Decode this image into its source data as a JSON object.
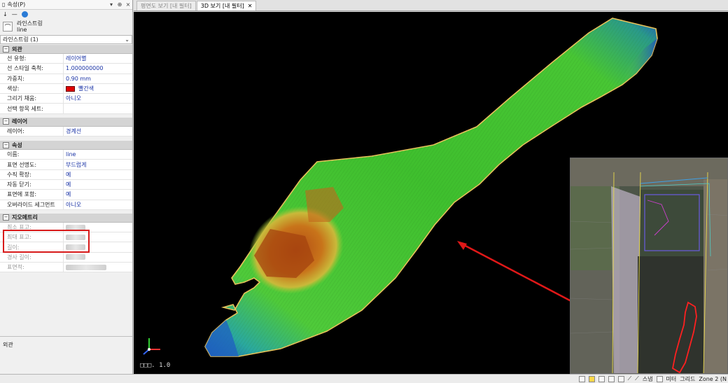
{
  "panel": {
    "title": "속성(P)",
    "object_type": "라인스트링",
    "object_name": "line",
    "selector": "라인스트링 (1)",
    "sections": {
      "appearance": {
        "title": "외관",
        "rows": [
          {
            "key": "선 유형:",
            "value": "레이어별"
          },
          {
            "key": "선 스타일 축척:",
            "value": "1.000000000"
          },
          {
            "key": "가중치:",
            "value": "0.90 mm"
          },
          {
            "key": "색상:",
            "value": "빨간색"
          },
          {
            "key": "그리기 채움:",
            "value": "아니오"
          },
          {
            "key": "선택 항목 세트:",
            "value": ""
          }
        ]
      },
      "layer": {
        "title": "레이어",
        "rows": [
          {
            "key": "레이어:",
            "value": "경계선"
          }
        ]
      },
      "attributes": {
        "title": "속성",
        "rows": [
          {
            "key": "이름:",
            "value": "line"
          },
          {
            "key": "표면 선명도:",
            "value": "부드럽게"
          },
          {
            "key": "수직 확장:",
            "value": "예"
          },
          {
            "key": "자동 닫기:",
            "value": "예"
          },
          {
            "key": "표면에 포함:",
            "value": "예"
          },
          {
            "key": "오버라이드 세그먼트",
            "value": "아니오"
          }
        ]
      },
      "geometry": {
        "title": "지오메트리",
        "rows": [
          {
            "key": "최소 표고:"
          },
          {
            "key": "최대 표고:"
          },
          {
            "key": "길이:"
          },
          {
            "key": "경사 길이:"
          },
          {
            "key": "표면적:"
          }
        ]
      }
    },
    "footer_label": "외관"
  },
  "tabs": [
    {
      "label": "평면도 보기 [내 필터]",
      "active": false
    },
    {
      "label": "3D 보기 [내 필터]",
      "active": true
    }
  ],
  "viewport": {
    "scale_label": "□□□. 1.0"
  },
  "statusbar": {
    "unit_label": "미터",
    "snap_label": "스냅",
    "grid_label": "그리드",
    "zone_label": "Zone 2 (N"
  },
  "colors": {
    "boundary": "#e8c25a",
    "arrow": "#e01818",
    "highlight": "#d71a1a"
  }
}
